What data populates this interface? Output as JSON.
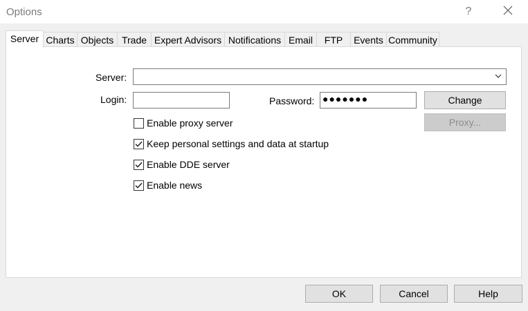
{
  "window": {
    "title": "Options",
    "help_glyph": "?",
    "close_glyph": "✕"
  },
  "tabs": [
    {
      "label": "Server",
      "active": true
    },
    {
      "label": "Charts"
    },
    {
      "label": "Objects"
    },
    {
      "label": "Trade"
    },
    {
      "label": "Expert Advisors"
    },
    {
      "label": "Notifications"
    },
    {
      "label": "Email"
    },
    {
      "label": "FTP"
    },
    {
      "label": "Events"
    },
    {
      "label": "Community"
    }
  ],
  "server": {
    "server_label": "Server:",
    "server_value": "",
    "login_label": "Login:",
    "login_value": "",
    "password_label": "Password:",
    "password_value": "●●●●●●●",
    "change_label": "Change",
    "proxy_label": "Proxy...",
    "checkboxes": [
      {
        "label": "Enable proxy server",
        "checked": false
      },
      {
        "label": "Keep personal settings and data at startup",
        "checked": true
      },
      {
        "label": "Enable DDE server",
        "checked": true
      },
      {
        "label": "Enable news",
        "checked": true
      }
    ]
  },
  "footer": {
    "ok_label": "OK",
    "cancel_label": "Cancel",
    "help_label": "Help"
  }
}
